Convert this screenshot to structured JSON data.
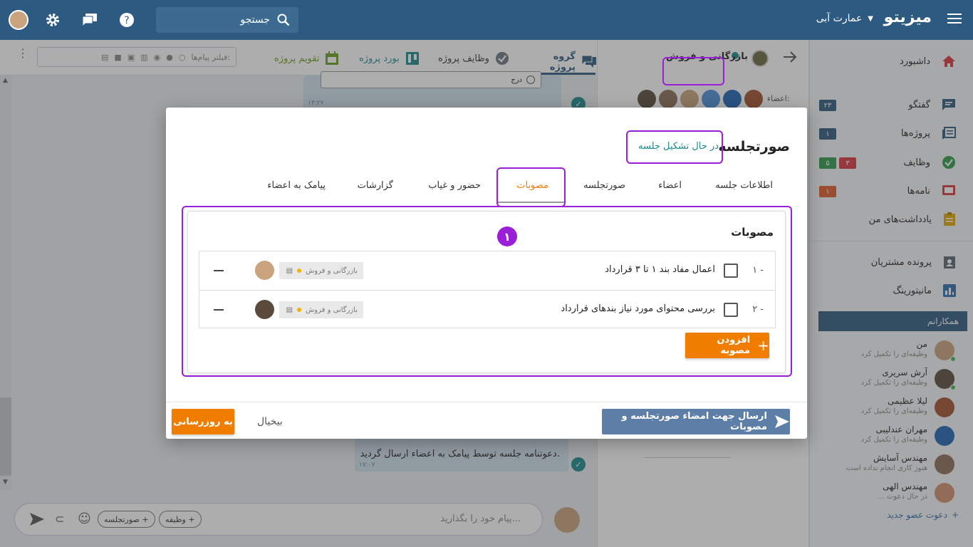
{
  "topbar": {
    "brand": "میزیتو",
    "org": "عمارت آبی",
    "search_placeholder": "جستجو"
  },
  "sidebar": {
    "items": [
      {
        "label": "داشبورد",
        "icon": "home-icon",
        "color": "#d9363e"
      },
      {
        "label": "گفتگو",
        "icon": "chat-icon",
        "color": "#2d5a80",
        "badges": [
          {
            "text": "۲۳",
            "color": "#2d5a80"
          }
        ]
      },
      {
        "label": "پروژه‌ها",
        "icon": "projects-icon",
        "color": "#2d5a80",
        "badges": [
          {
            "text": "۱",
            "color": "#2d5a80"
          }
        ]
      },
      {
        "label": "وظایف",
        "icon": "check-circle-icon",
        "color": "#2e9a4c",
        "badges": [
          {
            "text": "۵",
            "color": "#2e9a4c"
          },
          {
            "text": "۳",
            "color": "#d9363e"
          }
        ]
      },
      {
        "label": "نامه‌ها",
        "icon": "mail-icon",
        "color": "#d9363e",
        "badges": [
          {
            "text": "۱",
            "color": "#e05a2b"
          }
        ]
      },
      {
        "label": "یادداشت‌های من",
        "icon": "notes-icon",
        "color": "#e0a800"
      },
      {
        "label": "پرونده مشتریان",
        "icon": "customer-file-icon",
        "color": "#5a6470"
      },
      {
        "label": "مانیتورینگ",
        "icon": "chart-icon",
        "color": "#2d6fb0"
      }
    ],
    "colleagues_title": "همکارانم",
    "colleagues": [
      {
        "name": "من",
        "status": "وظیفه‌ای را تکمیل کرد"
      },
      {
        "name": "آرش سریری",
        "status": "وظیفه‌ای را تکمیل کرد"
      },
      {
        "name": "لیلا عظیمی",
        "status": "وظیفه‌ای را تکمیل کرد"
      },
      {
        "name": "مهران عندلیبی",
        "status": "وظیفه‌ای را تکمیل کرد"
      },
      {
        "name": "مهندس آسایش",
        "status": "هنوز کاری انجام نداده است"
      },
      {
        "name": "مهندس الهی",
        "status": "در حال دعوت ..."
      }
    ],
    "invite": "دعوت عضو جدید"
  },
  "project": {
    "name": "بازرگانی و فروش",
    "members_label": "اعضاء:"
  },
  "tabs": {
    "group": "گروه پروژه",
    "tasks": "وظایف پروژه",
    "board": "بورد پروژه",
    "calendar": "تقویم پروژه"
  },
  "filter": {
    "placeholder": "فیلتر پیام‌ها:"
  },
  "chat": {
    "insert": "درج",
    "time1": "۱۳:۲۷",
    "msg": "دعوتنامه جلسه توسط پیامک به اعضاء ارسال گردید.",
    "time2": "۱۷:۰۷",
    "composer_placeholder": "پیام خود را بگذارید...",
    "chip_minutes": "+ صورتجلسه",
    "chip_task": "+ وظیفه"
  },
  "modal": {
    "title": "صورتجلسه",
    "status": "در حال تشکیل جلسه",
    "tabs": [
      "اطلاعات جلسه",
      "اعضاء",
      "صورتجلسه",
      "مصوبات",
      "حضور و غیاب",
      "گزارشات",
      "پیامک به اعضاء"
    ],
    "panel_title": "مصوبات",
    "resolutions": [
      {
        "num": "۱ -",
        "text": "اعمال مفاد بند ۱ تا ۳ قرارداد",
        "tag": "بازرگانی و فروش"
      },
      {
        "num": "۲ -",
        "text": "بررسی محتوای مورد نیاز بندهای قرارداد",
        "tag": "بازرگانی و فروش"
      }
    ],
    "add_label": "افزودن مصوبه",
    "step": "۱",
    "send_label": "ارسال جهت امضاء صورتجلسه و مصوبات",
    "cancel_label": "بیخیال",
    "update_label": "به روزرسانی"
  },
  "colors": {
    "primary": "#2d5a80",
    "accent": "#f07d00",
    "highlight": "#9b1fd8",
    "status": "#1a8a8a"
  }
}
